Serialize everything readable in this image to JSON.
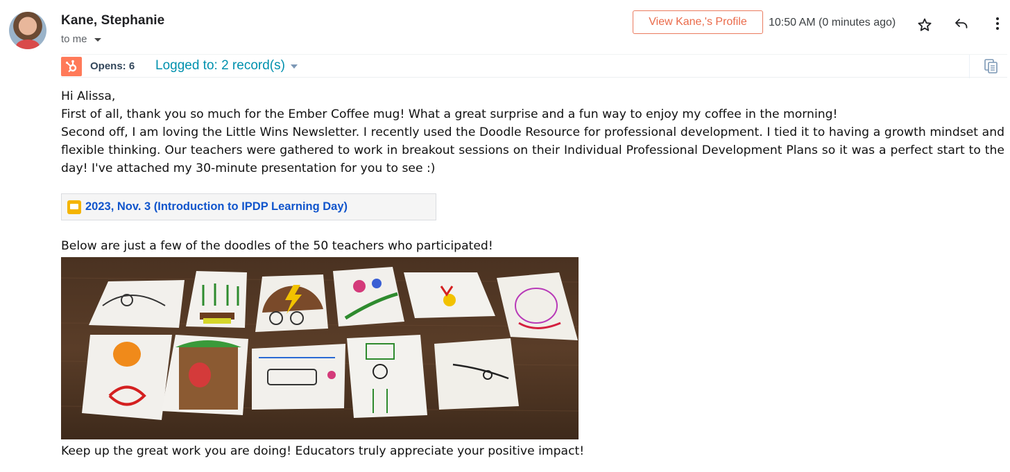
{
  "header": {
    "sender_name": "Kane, Stephanie",
    "recipient": "to me",
    "profile_button": "View Kane,'s Profile",
    "timestamp": "10:50 AM (0 minutes ago)"
  },
  "hubspot": {
    "opens": "Opens: 6",
    "logged": "Logged to: 2 record(s)",
    "accent_color": "#ff7a59",
    "link_color": "#0091ae"
  },
  "message": {
    "greeting": "Hi Alissa,",
    "line1": "First of all, thank you so much for the Ember Coffee mug!  What a great surprise and a fun way to enjoy my coffee in the morning!",
    "line2": "Second off, I am loving the Little Wins Newsletter. I recently used the Doodle Resource for professional development. I tied it to having a growth mindset and flexible thinking.  Our teachers were gathered to work in breakout sessions on their Individual Professional Development Plans so it was a perfect start to the day! I've attached my 30-minute presentation for you to see :)",
    "attachment_title": "2023, Nov. 3 (Introduction to IPDP Learning Day)",
    "below_image_intro": "Below are just a few of the doodles of the 50 teachers who participated!",
    "closing": "Keep up the great work you are doing!  Educators truly appreciate your positive impact!"
  },
  "icons": [
    "avatar",
    "star-icon",
    "reply-icon",
    "more-vert-icon",
    "hubspot-sprocket-icon",
    "caret-down-icon",
    "copy-icon",
    "google-slides-icon"
  ]
}
